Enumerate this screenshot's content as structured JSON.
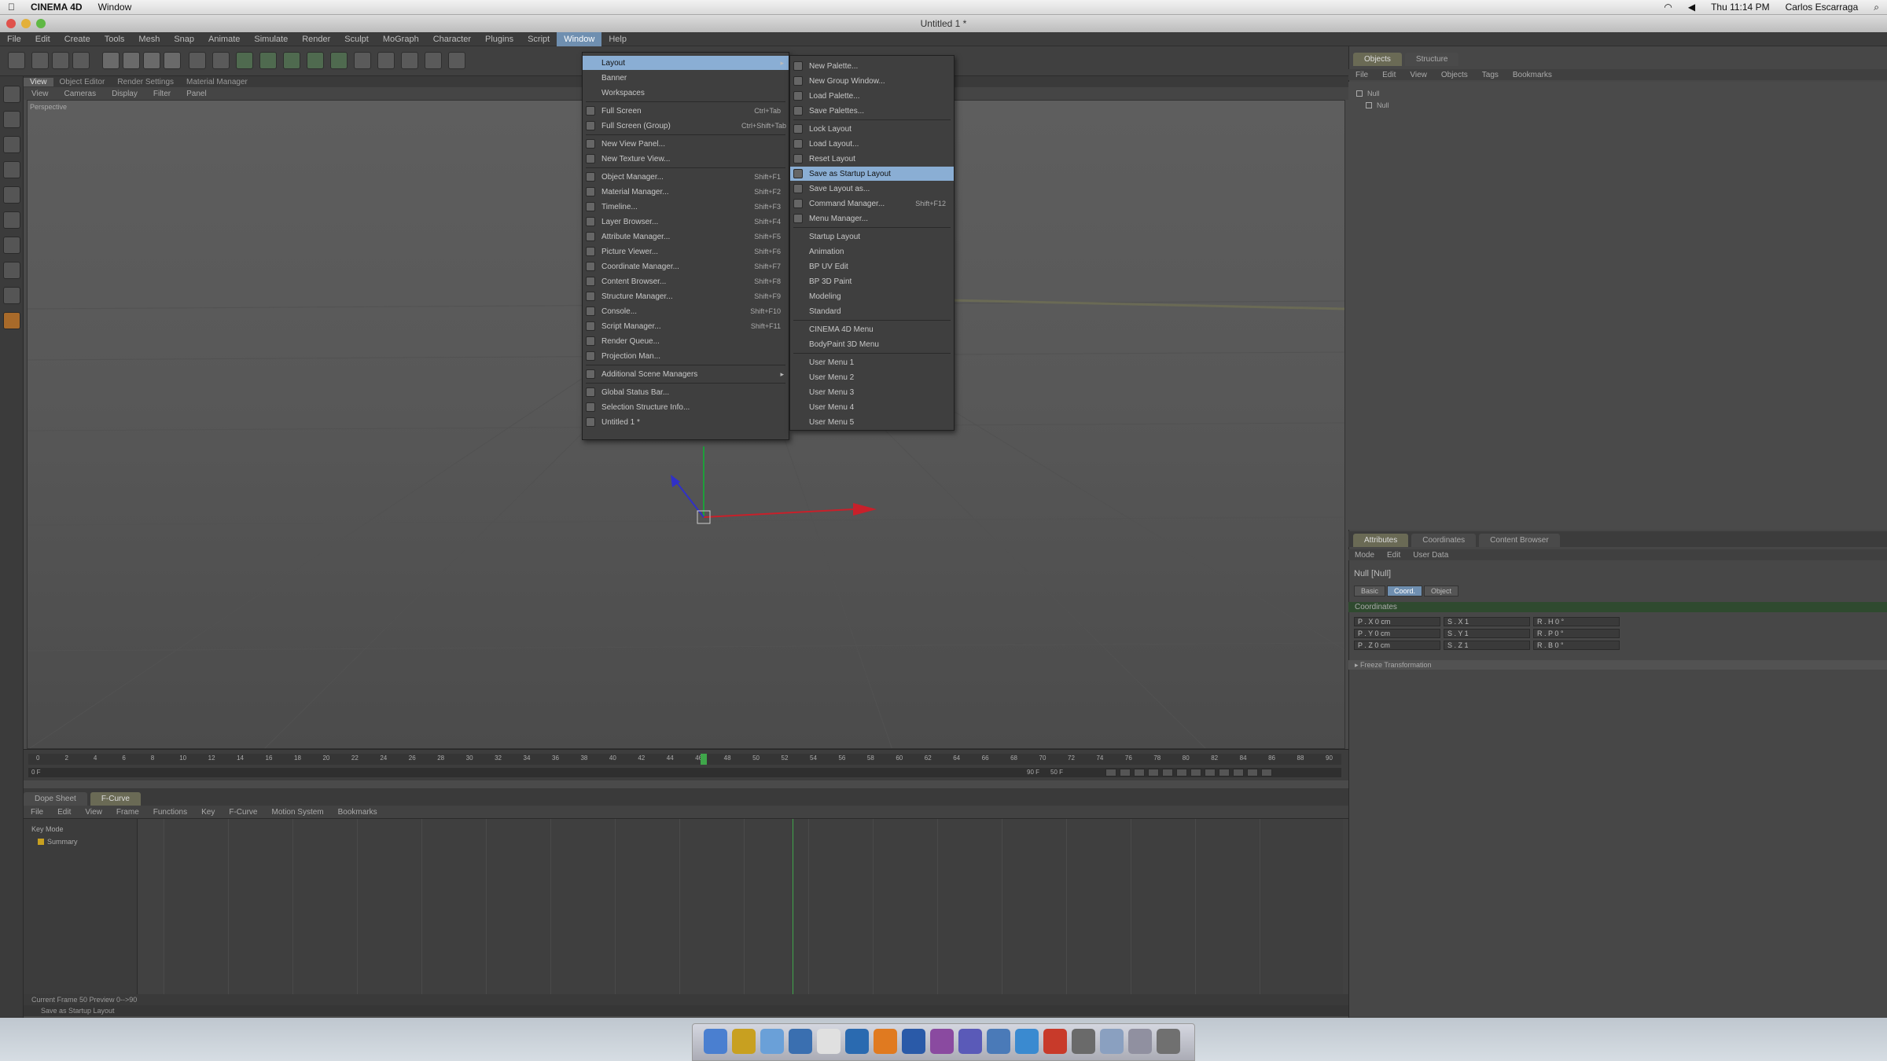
{
  "mac_menubar": {
    "apple": "",
    "app_name": "CINEMA 4D",
    "menus": [
      "Window"
    ],
    "clock": "Thu 11:14 PM",
    "user": "Carlos Escarraga"
  },
  "window": {
    "title": "Untitled 1 *"
  },
  "c4d_menu": {
    "items": [
      "File",
      "Edit",
      "Create",
      "Tools",
      "Mesh",
      "Snap",
      "Animate",
      "Simulate",
      "Render",
      "Sculpt",
      "MoGraph",
      "Character",
      "Plugins",
      "Script",
      "Window",
      "Help"
    ],
    "active_index": 14
  },
  "viewport": {
    "tabs": [
      "View",
      "Cameras",
      "Display",
      "Filter",
      "Panel"
    ],
    "header_tabs": [
      "View",
      "Object Editor",
      "Render Settings",
      "Material Manager"
    ],
    "label": "Perspective"
  },
  "window_menu": {
    "items": [
      {
        "label": "Layout",
        "shortcut": "",
        "icon": false,
        "submenu": true,
        "highlighted": true
      },
      {
        "label": "Banner",
        "shortcut": "",
        "icon": false
      },
      {
        "label": "Workspaces",
        "shortcut": "",
        "icon": false
      },
      {
        "label": "Full Screen",
        "shortcut": "Ctrl+Tab",
        "icon": true
      },
      {
        "label": "Full Screen (Group)",
        "shortcut": "Ctrl+Shift+Tab",
        "icon": true
      },
      {
        "label": "New View Panel...",
        "shortcut": "",
        "icon": true
      },
      {
        "label": "New Texture View...",
        "shortcut": "",
        "icon": true
      },
      {
        "label": "Object Manager...",
        "shortcut": "Shift+F1",
        "icon": true
      },
      {
        "label": "Material Manager...",
        "shortcut": "Shift+F2",
        "icon": true
      },
      {
        "label": "Timeline...",
        "shortcut": "Shift+F3",
        "icon": true
      },
      {
        "label": "Layer Browser...",
        "shortcut": "Shift+F4",
        "icon": true
      },
      {
        "label": "Attribute Manager...",
        "shortcut": "Shift+F5",
        "icon": true
      },
      {
        "label": "Picture Viewer...",
        "shortcut": "Shift+F6",
        "icon": true
      },
      {
        "label": "Coordinate Manager...",
        "shortcut": "Shift+F7",
        "icon": true
      },
      {
        "label": "Content Browser...",
        "shortcut": "Shift+F8",
        "icon": true
      },
      {
        "label": "Structure Manager...",
        "shortcut": "Shift+F9",
        "icon": true
      },
      {
        "label": "Console...",
        "shortcut": "Shift+F10",
        "icon": true
      },
      {
        "label": "Script Manager...",
        "shortcut": "Shift+F11",
        "icon": true
      },
      {
        "label": "Render Queue...",
        "shortcut": "",
        "icon": true
      },
      {
        "label": "Projection Man...",
        "shortcut": "",
        "icon": true
      },
      {
        "label": "Additional Scene Managers",
        "shortcut": "",
        "icon": true,
        "submenu": true
      },
      {
        "label": "Global Status Bar...",
        "shortcut": "",
        "icon": true
      },
      {
        "label": "Selection Structure Info...",
        "shortcut": "",
        "icon": true
      },
      {
        "label": "Untitled 1 *",
        "shortcut": "",
        "icon": true
      }
    ]
  },
  "layout_submenu": {
    "items": [
      {
        "label": "New Palette...",
        "shortcut": "",
        "icon": true
      },
      {
        "label": "New Group Window...",
        "shortcut": "",
        "icon": true
      },
      {
        "label": "Load Palette...",
        "shortcut": "",
        "icon": true
      },
      {
        "label": "Save Palettes...",
        "shortcut": "",
        "icon": true
      },
      {
        "label": "Lock Layout",
        "shortcut": "",
        "icon": true
      },
      {
        "label": "Load Layout...",
        "shortcut": "",
        "icon": true
      },
      {
        "label": "Reset Layout",
        "shortcut": "",
        "icon": true
      },
      {
        "label": "Save as Startup Layout",
        "shortcut": "",
        "icon": true,
        "highlighted": true
      },
      {
        "label": "Save Layout as...",
        "shortcut": "",
        "icon": true
      },
      {
        "label": "Command Manager...",
        "shortcut": "Shift+F12",
        "icon": true
      },
      {
        "label": "Menu Manager...",
        "shortcut": "",
        "icon": true
      },
      {
        "label": "Startup Layout",
        "shortcut": "",
        "icon": false
      },
      {
        "label": "Animation",
        "shortcut": "",
        "icon": false
      },
      {
        "label": "BP UV Edit",
        "shortcut": "",
        "icon": false
      },
      {
        "label": "BP 3D Paint",
        "shortcut": "",
        "icon": false
      },
      {
        "label": "Modeling",
        "shortcut": "",
        "icon": false
      },
      {
        "label": "Standard",
        "shortcut": "",
        "icon": false
      },
      {
        "label": "CINEMA 4D Menu",
        "shortcut": "",
        "icon": false
      },
      {
        "label": "BodyPaint 3D Menu",
        "shortcut": "",
        "icon": false
      },
      {
        "label": "User Menu 1",
        "shortcut": "",
        "icon": false
      },
      {
        "label": "User Menu 2",
        "shortcut": "",
        "icon": false
      },
      {
        "label": "User Menu 3",
        "shortcut": "",
        "icon": false
      },
      {
        "label": "User Menu 4",
        "shortcut": "",
        "icon": false
      },
      {
        "label": "User Menu 5",
        "shortcut": "",
        "icon": false
      }
    ]
  },
  "object_manager": {
    "tabs": [
      "Objects",
      "Structure"
    ],
    "menu": [
      "File",
      "Edit",
      "View",
      "Objects",
      "Tags",
      "Bookmarks"
    ],
    "objects": [
      "Null",
      "Null"
    ]
  },
  "attribute_manager": {
    "tabs": [
      "Attributes",
      "Coordinates",
      "Content Browser"
    ],
    "menu": [
      "Mode",
      "Edit",
      "User Data"
    ],
    "title": "Null [Null]",
    "subtabs": [
      "Basic",
      "Coord.",
      "Object"
    ],
    "section": "Coordinates",
    "rows": [
      {
        "pos": "P . X  0 cm",
        "scale": "S . X  1",
        "rot": "R . H  0 °"
      },
      {
        "pos": "P . Y  0 cm",
        "scale": "S . Y  1",
        "rot": "R . P  0 °"
      },
      {
        "pos": "P . Z  0 cm",
        "scale": "S . Z  1",
        "rot": "R . B  0 °"
      }
    ],
    "quat": "▸ Freeze Transformation"
  },
  "timeline": {
    "ticks": [
      "0",
      "2",
      "4",
      "6",
      "8",
      "10",
      "12",
      "14",
      "16",
      "18",
      "20",
      "22",
      "24",
      "26",
      "28",
      "30",
      "32",
      "34",
      "36",
      "38",
      "40",
      "42",
      "44",
      "46",
      "48",
      "50",
      "52",
      "54",
      "56",
      "58",
      "60",
      "62",
      "64",
      "66",
      "68",
      "70",
      "72",
      "74",
      "76",
      "78",
      "80",
      "82",
      "84",
      "86",
      "88",
      "90"
    ],
    "current": "50 F",
    "start": "0 F",
    "end": "90 F"
  },
  "dope_sheet": {
    "tabs": [
      "Dope Sheet",
      "F-Curve"
    ],
    "menu": [
      "File",
      "Edit",
      "View",
      "Frame",
      "Functions",
      "Key",
      "F-Curve",
      "Motion System",
      "Bookmarks"
    ],
    "tree_header": "Key Mode",
    "tree_items": [
      "Summary"
    ]
  },
  "status": {
    "line1": "Current Frame  50  Preview  0-->90",
    "line2": "Save as Startup Layout"
  },
  "colors": {
    "accent": "#6f8fb0",
    "highlight": "#8aaed4",
    "axis_x": "#c8202a",
    "axis_y": "#1e9e3a",
    "axis_z": "#3030c8"
  }
}
